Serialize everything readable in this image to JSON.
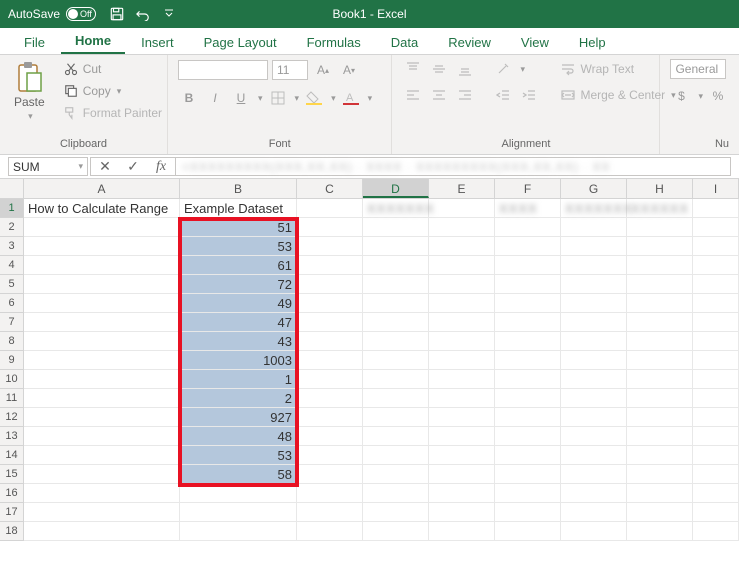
{
  "title": {
    "autosave_label": "AutoSave",
    "autosave_state": "Off",
    "doc": "Book1 - Excel"
  },
  "tabs": {
    "file": "File",
    "home": "Home",
    "insert": "Insert",
    "layout": "Page Layout",
    "formulas": "Formulas",
    "data": "Data",
    "review": "Review",
    "view": "View",
    "help": "Help"
  },
  "ribbon": {
    "paste": "Paste",
    "cut": "Cut",
    "copy": "Copy",
    "fmtpainter": "Format Painter",
    "clipboard": "Clipboard",
    "font_group": "Font",
    "fontsize": "11",
    "bold": "B",
    "italic": "I",
    "underline": "U",
    "align_group": "Alignment",
    "wrap": "Wrap Text",
    "merge": "Merge & Center",
    "number_group": "Nu",
    "general": "General",
    "dollar": "$",
    "percent": "%"
  },
  "fbar": {
    "name": "SUM",
    "fx": "fx"
  },
  "columns": [
    "A",
    "B",
    "C",
    "D",
    "E",
    "F",
    "G",
    "H",
    "I"
  ],
  "cells": {
    "A1": "How to Calculate Range",
    "B1": "Example Dataset",
    "B2": "51",
    "B3": "53",
    "B4": "61",
    "B5": "72",
    "B6": "49",
    "B7": "47",
    "B8": "43",
    "B9": "1003",
    "B10": "1",
    "B11": "2",
    "B12": "927",
    "B13": "48",
    "B14": "53",
    "B15": "58"
  },
  "rows": 18
}
